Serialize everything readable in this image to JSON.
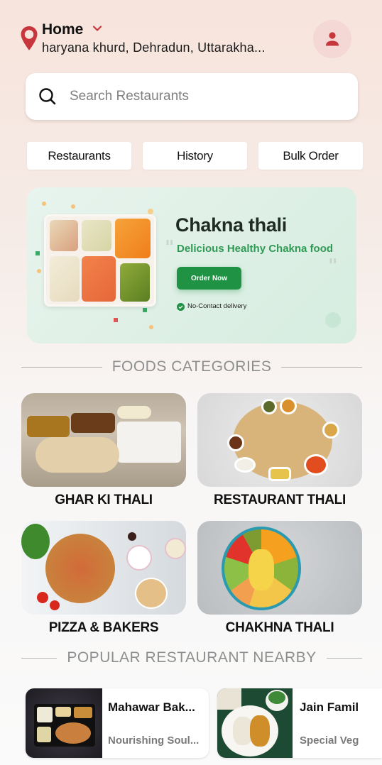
{
  "header": {
    "location_label": "Home",
    "address": "haryana khurd, Dehradun, Uttarakha...",
    "icons": {
      "location": "map-pin-icon",
      "dropdown": "chevron-down-icon",
      "profile": "user-icon"
    }
  },
  "search": {
    "placeholder": "Search Restaurants",
    "value": "",
    "icon": "search-icon"
  },
  "tabs": [
    {
      "label": "Restaurants"
    },
    {
      "label": "History"
    },
    {
      "label": "Bulk Order"
    }
  ],
  "banner": {
    "title": "Chakna thali",
    "subtitle": "Delicious Healthy Chakna food",
    "button_label": "Order Now",
    "note": "No-Contact delivery",
    "accent_color": "#1f9244"
  },
  "categories": {
    "heading": "FOODS CATEGORIES",
    "items": [
      {
        "label": "GHAR KI THALI"
      },
      {
        "label": "RESTAURANT THALI"
      },
      {
        "label": "PIZZA & BAKERS"
      },
      {
        "label": "CHAKHNA THALI"
      }
    ]
  },
  "popular": {
    "heading": "POPULAR RESTAURANT NEARBY",
    "items": [
      {
        "name": "Mahawar Bak...",
        "description": "Nourishing Soul..."
      },
      {
        "name": "Jain Famil",
        "description": "Special Veg"
      }
    ]
  },
  "colors": {
    "brand_red": "#c8363d",
    "profile_bg": "#f3d8d6",
    "section_heading": "#8e8e8e"
  }
}
